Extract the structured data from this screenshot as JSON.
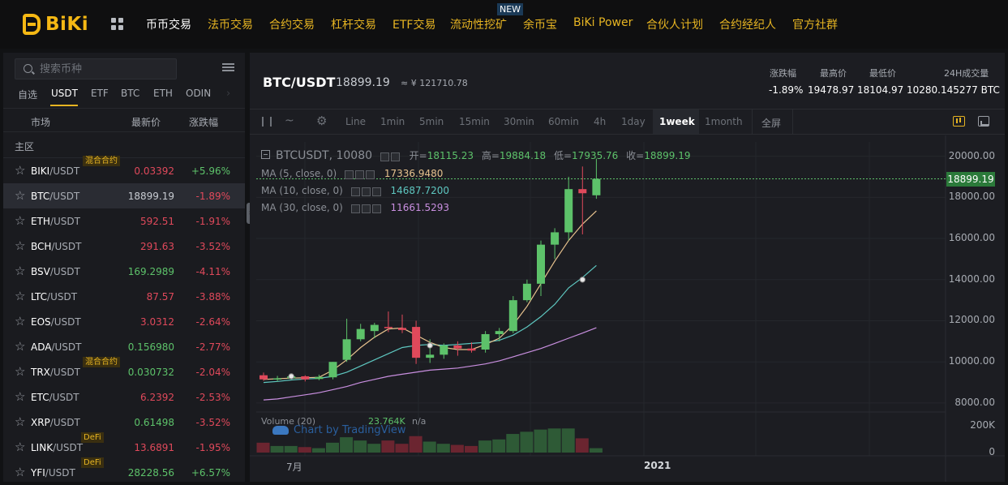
{
  "brand": {
    "name": "BiKi"
  },
  "nav": {
    "items": [
      "币币交易",
      "法币交易",
      "合约交易",
      "杠杆交易",
      "ETF交易",
      "流动性挖矿",
      "余币宝",
      "BiKi Power",
      "合伙人计划",
      "合约经纪人",
      "官方社群"
    ],
    "new_badge": "NEW"
  },
  "market": {
    "search_placeholder": "搜索币种",
    "tabs": [
      "自选",
      "USDT",
      "ETF",
      "BTC",
      "ETH",
      "ODIN"
    ],
    "active_tab": "USDT",
    "tab_more_arrow": "›",
    "headers": {
      "market": "市场",
      "price": "最新价",
      "change": "涨跌幅"
    },
    "section": "主区",
    "rows": [
      {
        "base": "BIKI",
        "quote": "/USDT",
        "price": "0.03392",
        "change": "+5.96%",
        "dir": "down",
        "cdir": "up",
        "tag": "混合合约"
      },
      {
        "base": "BTC",
        "quote": "/USDT",
        "price": "18899.19",
        "change": "-1.89%",
        "dir": "neutral",
        "cdir": "down",
        "tag": ""
      },
      {
        "base": "ETH",
        "quote": "/USDT",
        "price": "592.51",
        "change": "-1.91%",
        "dir": "down",
        "cdir": "down",
        "tag": ""
      },
      {
        "base": "BCH",
        "quote": "/USDT",
        "price": "291.63",
        "change": "-3.52%",
        "dir": "down",
        "cdir": "down",
        "tag": ""
      },
      {
        "base": "BSV",
        "quote": "/USDT",
        "price": "169.2989",
        "change": "-4.11%",
        "dir": "up",
        "cdir": "down",
        "tag": ""
      },
      {
        "base": "LTC",
        "quote": "/USDT",
        "price": "87.57",
        "change": "-3.88%",
        "dir": "down",
        "cdir": "down",
        "tag": ""
      },
      {
        "base": "EOS",
        "quote": "/USDT",
        "price": "3.0312",
        "change": "-2.64%",
        "dir": "down",
        "cdir": "down",
        "tag": ""
      },
      {
        "base": "ADA",
        "quote": "/USDT",
        "price": "0.156980",
        "change": "-2.77%",
        "dir": "up",
        "cdir": "down",
        "tag": ""
      },
      {
        "base": "TRX",
        "quote": "/USDT",
        "price": "0.030732",
        "change": "-2.04%",
        "dir": "up",
        "cdir": "down",
        "tag": "混合合约"
      },
      {
        "base": "ETC",
        "quote": "/USDT",
        "price": "6.2392",
        "change": "-2.53%",
        "dir": "down",
        "cdir": "down",
        "tag": ""
      },
      {
        "base": "XRP",
        "quote": "/USDT",
        "price": "0.61498",
        "change": "-3.52%",
        "dir": "up",
        "cdir": "down",
        "tag": ""
      },
      {
        "base": "LINK",
        "quote": "/USDT",
        "price": "13.6891",
        "change": "-1.95%",
        "dir": "down",
        "cdir": "down",
        "tag": "DeFi"
      },
      {
        "base": "YFI",
        "quote": "/USDT",
        "price": "28228.56",
        "change": "+6.57%",
        "dir": "up",
        "cdir": "up",
        "tag": "DeFi"
      }
    ]
  },
  "ticker": {
    "pair": "BTC/USDT",
    "price": "18899.19",
    "cny": "≈ ¥ 121710.78",
    "stats": [
      {
        "label": "涨跌幅",
        "value": "-1.89%",
        "dir": "down"
      },
      {
        "label": "最高价",
        "value": "19478.97",
        "dir": "neutral"
      },
      {
        "label": "最低价",
        "value": "18104.97",
        "dir": "neutral"
      },
      {
        "label": "24H成交量",
        "value": "10280.145277 BTC",
        "dir": "neutral"
      }
    ]
  },
  "toolbar": {
    "intervals": [
      "Line",
      "1min",
      "5min",
      "15min",
      "30min",
      "60min",
      "4h",
      "1day",
      "1week",
      "1month"
    ],
    "active": "1week",
    "fullscreen": "全屏"
  },
  "chart_header": {
    "symbol": "BTCUSDT, 10080",
    "open_label": "开=",
    "open": "18115.23",
    "high_label": "高=",
    "high": "19884.18",
    "low_label": "低=",
    "low": "17935.76",
    "close_label": "收=",
    "close": "18899.19",
    "ma5_label": "MA (5, close, 0)",
    "ma5": "17336.9480",
    "ma10_label": "MA (10, close, 0)",
    "ma10": "14687.7200",
    "ma30_label": "MA (30, close, 0)",
    "ma30": "11661.5293",
    "volume_label": "Volume (20)",
    "volume": "23.764K",
    "volume_na": "n/a",
    "last_price_tag": "18899.19",
    "watermark": "Chart by TradingView"
  },
  "colors": {
    "up": "#5dc26a",
    "down": "#e0495b",
    "ma5": "#e7c28e",
    "ma10": "#5ec7c0",
    "ma30": "#c98fe0",
    "accent": "#e6b422"
  },
  "chart_data": {
    "type": "candlestick",
    "interval": "1week",
    "y_ticks": [
      "20000.00",
      "18000.00",
      "16000.00",
      "14000.00",
      "12000.00",
      "10000.00",
      "8000.00"
    ],
    "ylim": [
      7800,
      20300
    ],
    "volume_ticks": [
      "200K",
      "0"
    ],
    "x_ticks": [
      "7月",
      "2021"
    ],
    "candles": [
      {
        "o": 9350,
        "h": 9480,
        "l": 9080,
        "c": 9150
      },
      {
        "o": 9180,
        "h": 9320,
        "l": 9050,
        "c": 9200
      },
      {
        "o": 9200,
        "h": 9400,
        "l": 9150,
        "c": 9300
      },
      {
        "o": 9300,
        "h": 9350,
        "l": 9050,
        "c": 9150
      },
      {
        "o": 9170,
        "h": 9380,
        "l": 9110,
        "c": 9270
      },
      {
        "o": 9250,
        "h": 10000,
        "l": 9150,
        "c": 10000
      },
      {
        "o": 10100,
        "h": 12100,
        "l": 10000,
        "c": 11100
      },
      {
        "o": 11100,
        "h": 11850,
        "l": 11000,
        "c": 11600
      },
      {
        "o": 11500,
        "h": 11900,
        "l": 11150,
        "c": 11800
      },
      {
        "o": 11700,
        "h": 12450,
        "l": 11450,
        "c": 11650
      },
      {
        "o": 11650,
        "h": 12300,
        "l": 11400,
        "c": 11550
      },
      {
        "o": 11700,
        "h": 12000,
        "l": 9900,
        "c": 10200
      },
      {
        "o": 10200,
        "h": 11100,
        "l": 9950,
        "c": 10350
      },
      {
        "o": 10350,
        "h": 10900,
        "l": 10150,
        "c": 10800
      },
      {
        "o": 10800,
        "h": 11000,
        "l": 10300,
        "c": 10650
      },
      {
        "o": 10650,
        "h": 10950,
        "l": 10450,
        "c": 10550
      },
      {
        "o": 10600,
        "h": 11500,
        "l": 10450,
        "c": 11350
      },
      {
        "o": 11350,
        "h": 11650,
        "l": 11000,
        "c": 11500
      },
      {
        "o": 11500,
        "h": 13200,
        "l": 11400,
        "c": 13000
      },
      {
        "o": 13000,
        "h": 14000,
        "l": 12900,
        "c": 13800
      },
      {
        "o": 13800,
        "h": 15900,
        "l": 13200,
        "c": 15700
      },
      {
        "o": 15700,
        "h": 16500,
        "l": 15000,
        "c": 16300
      },
      {
        "o": 16300,
        "h": 19000,
        "l": 15900,
        "c": 18400
      },
      {
        "o": 18400,
        "h": 19500,
        "l": 16200,
        "c": 18200
      },
      {
        "o": 18100,
        "h": 19880,
        "l": 17930,
        "c": 18899
      }
    ],
    "volumes": [
      45,
      30,
      30,
      25,
      20,
      45,
      70,
      55,
      40,
      55,
      40,
      75,
      50,
      40,
      35,
      30,
      55,
      60,
      85,
      95,
      105,
      110,
      110,
      65,
      20
    ],
    "ma_points": {
      "ma5": [
        9150,
        9180,
        9210,
        9230,
        9250,
        9600,
        10100,
        10700,
        11200,
        11600,
        11650,
        11300,
        10950,
        10700,
        10600,
        10600,
        10850,
        11150,
        11800,
        12700,
        13800,
        14900,
        15900,
        16700,
        17337
      ],
      "ma10": [
        9000,
        9050,
        9120,
        9170,
        9200,
        9300,
        9500,
        9800,
        10100,
        10400,
        10700,
        10800,
        10850,
        10800,
        10850,
        10900,
        10950,
        11050,
        11300,
        11700,
        12200,
        12800,
        13600,
        14100,
        14688
      ],
      "ma30": [
        8150,
        8200,
        8300,
        8400,
        8500,
        8650,
        8800,
        9000,
        9150,
        9300,
        9400,
        9500,
        9600,
        9650,
        9700,
        9800,
        9900,
        10050,
        10250,
        10450,
        10650,
        10900,
        11150,
        11400,
        11662
      ]
    }
  }
}
